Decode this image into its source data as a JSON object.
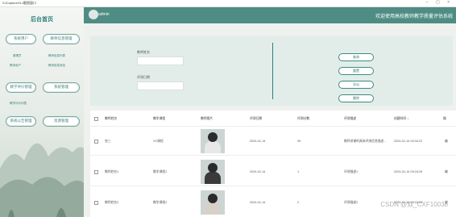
{
  "titlebar": {
    "title": "SJCaptureHLJ截图窗口"
  },
  "sidebar": {
    "title": "后台首页",
    "menus": {
      "user_mgmt": "系统用户",
      "teacher_mgmt": "教师信息管理",
      "teacher_eval_mgmt": "教学评价管理",
      "system_mgmt": "系统管理",
      "notice_mgmt": "系统公告管理",
      "resource_mgmt": "资源管理"
    },
    "subs": {
      "s1": "管理员",
      "s2": "教师信息列表",
      "s3": "教师用户",
      "s4": "教师信息添加",
      "s5": "教学评价列表"
    }
  },
  "topbar": {
    "user": "admin",
    "welcome": "欢迎使用高校教师教学质量评估系统"
  },
  "search": {
    "label_name": "教师姓名",
    "label_date": "评测日期",
    "btn_search": "查询",
    "btn_reset": "重置",
    "btn_export": "导出",
    "btn_delete": "删除"
  },
  "table": {
    "headers": [
      "教师姓名",
      "教学课程",
      "教师图片",
      "评测日期",
      "评测分数",
      "评测描述",
      "创建时间 ↕",
      "操"
    ],
    "rows": [
      {
        "name": "张三",
        "course": "XX课程",
        "date": "2024-01-14",
        "score": "93",
        "desc": "教师讲课的具体评测信息描述...",
        "created": "2024-01-14 09:34:22",
        "op": "编"
      },
      {
        "name": "教师姓名1",
        "course": "教学课程1",
        "date": "2024-01-14",
        "score": "1",
        "desc": "评测描述1",
        "created": "2024-01-14 09:16:29",
        "op": "编"
      },
      {
        "name": "教师姓名2",
        "course": "教学课程2",
        "date": "2024-01-14",
        "score": "2",
        "desc": "评测描述2",
        "created": "2024-01-14 09:16:29",
        "op": "编"
      }
    ]
  },
  "watermark": "CSDN @双_CXF10038",
  "colors": {
    "primary": "#4f8c84",
    "accent": "#2f7f76",
    "bg": "#eef1ee"
  }
}
